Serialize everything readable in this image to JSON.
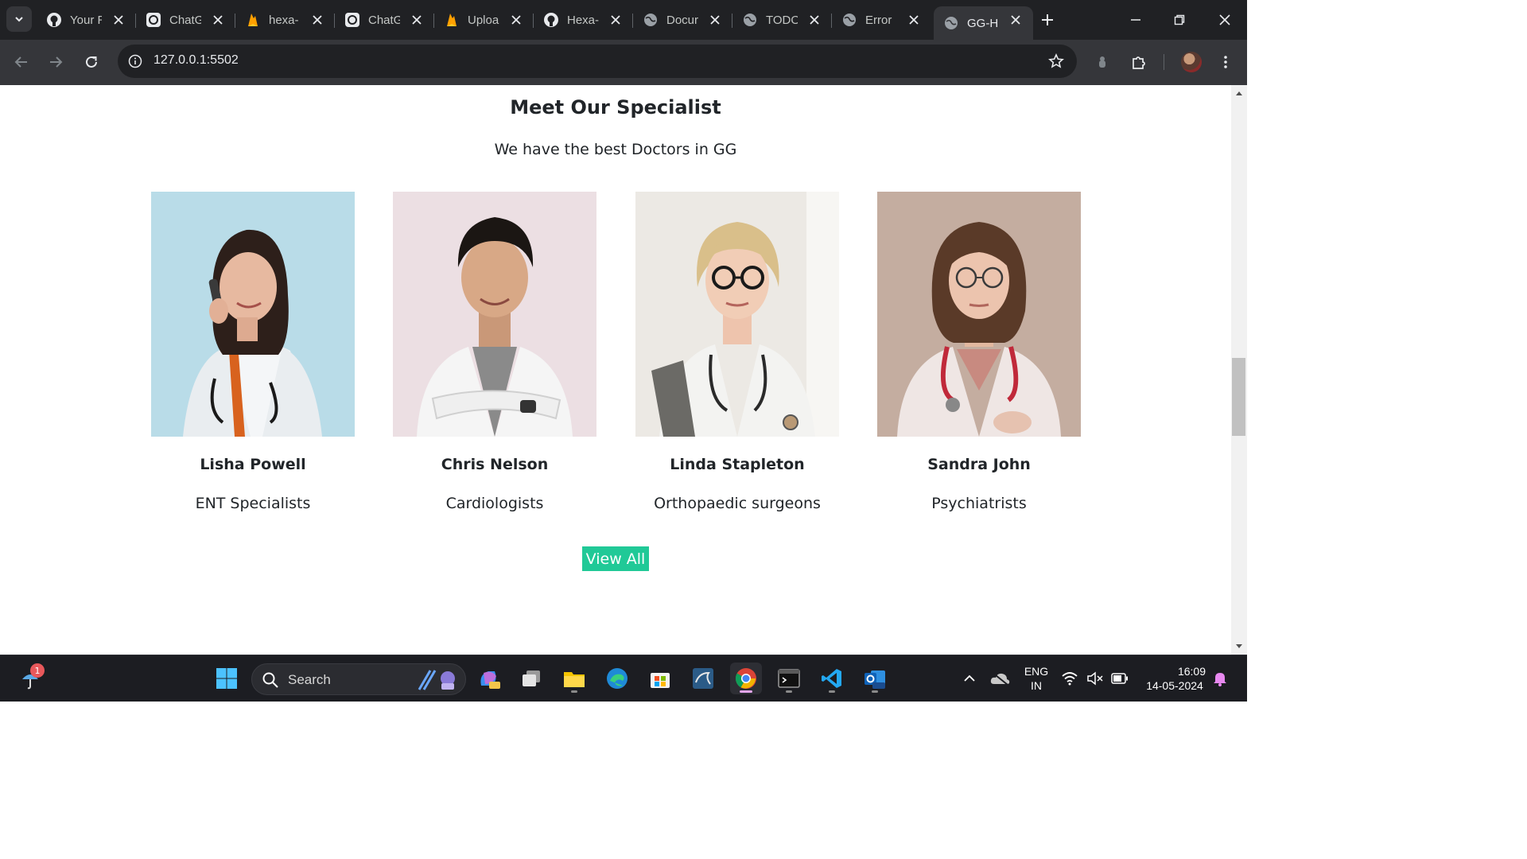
{
  "browser": {
    "tabs": [
      {
        "title": "Your R",
        "favicon": "github-icon"
      },
      {
        "title": "ChatG",
        "favicon": "chatgpt-icon"
      },
      {
        "title": "hexa-",
        "favicon": "firebase-icon"
      },
      {
        "title": "ChatG",
        "favicon": "chatgpt-icon"
      },
      {
        "title": "Uploa",
        "favicon": "firebase-icon"
      },
      {
        "title": "Hexa-",
        "favicon": "github-icon"
      },
      {
        "title": "Docur",
        "favicon": "globe-icon"
      },
      {
        "title": "TODO",
        "favicon": "globe-icon"
      },
      {
        "title": "Error",
        "favicon": "globe-icon"
      },
      {
        "title": "GG-H",
        "favicon": "globe-icon",
        "active": true
      }
    ],
    "url": "127.0.0.1:5502"
  },
  "page": {
    "heading": "Meet Our Specialist",
    "subheading": "We have the best Doctors in GG",
    "doctors": [
      {
        "name": "Lisha Powell",
        "role": "ENT Specialists",
        "photo_bg": "#b9dce8"
      },
      {
        "name": "Chris Nelson",
        "role": "Cardiologists",
        "photo_bg": "#ecdfe3"
      },
      {
        "name": "Linda Stapleton",
        "role": "Orthopaedic surgeons",
        "photo_bg": "#ece9e4"
      },
      {
        "name": "Sandra John",
        "role": "Psychiatrists",
        "photo_bg": "#c4ada0"
      }
    ],
    "view_all_label": "View All",
    "accent_color": "#20c997"
  },
  "taskbar": {
    "search_label": "Search",
    "notification_count": "1",
    "language": "ENG",
    "region": "IN",
    "time": "16:09",
    "date": "14-05-2024"
  }
}
